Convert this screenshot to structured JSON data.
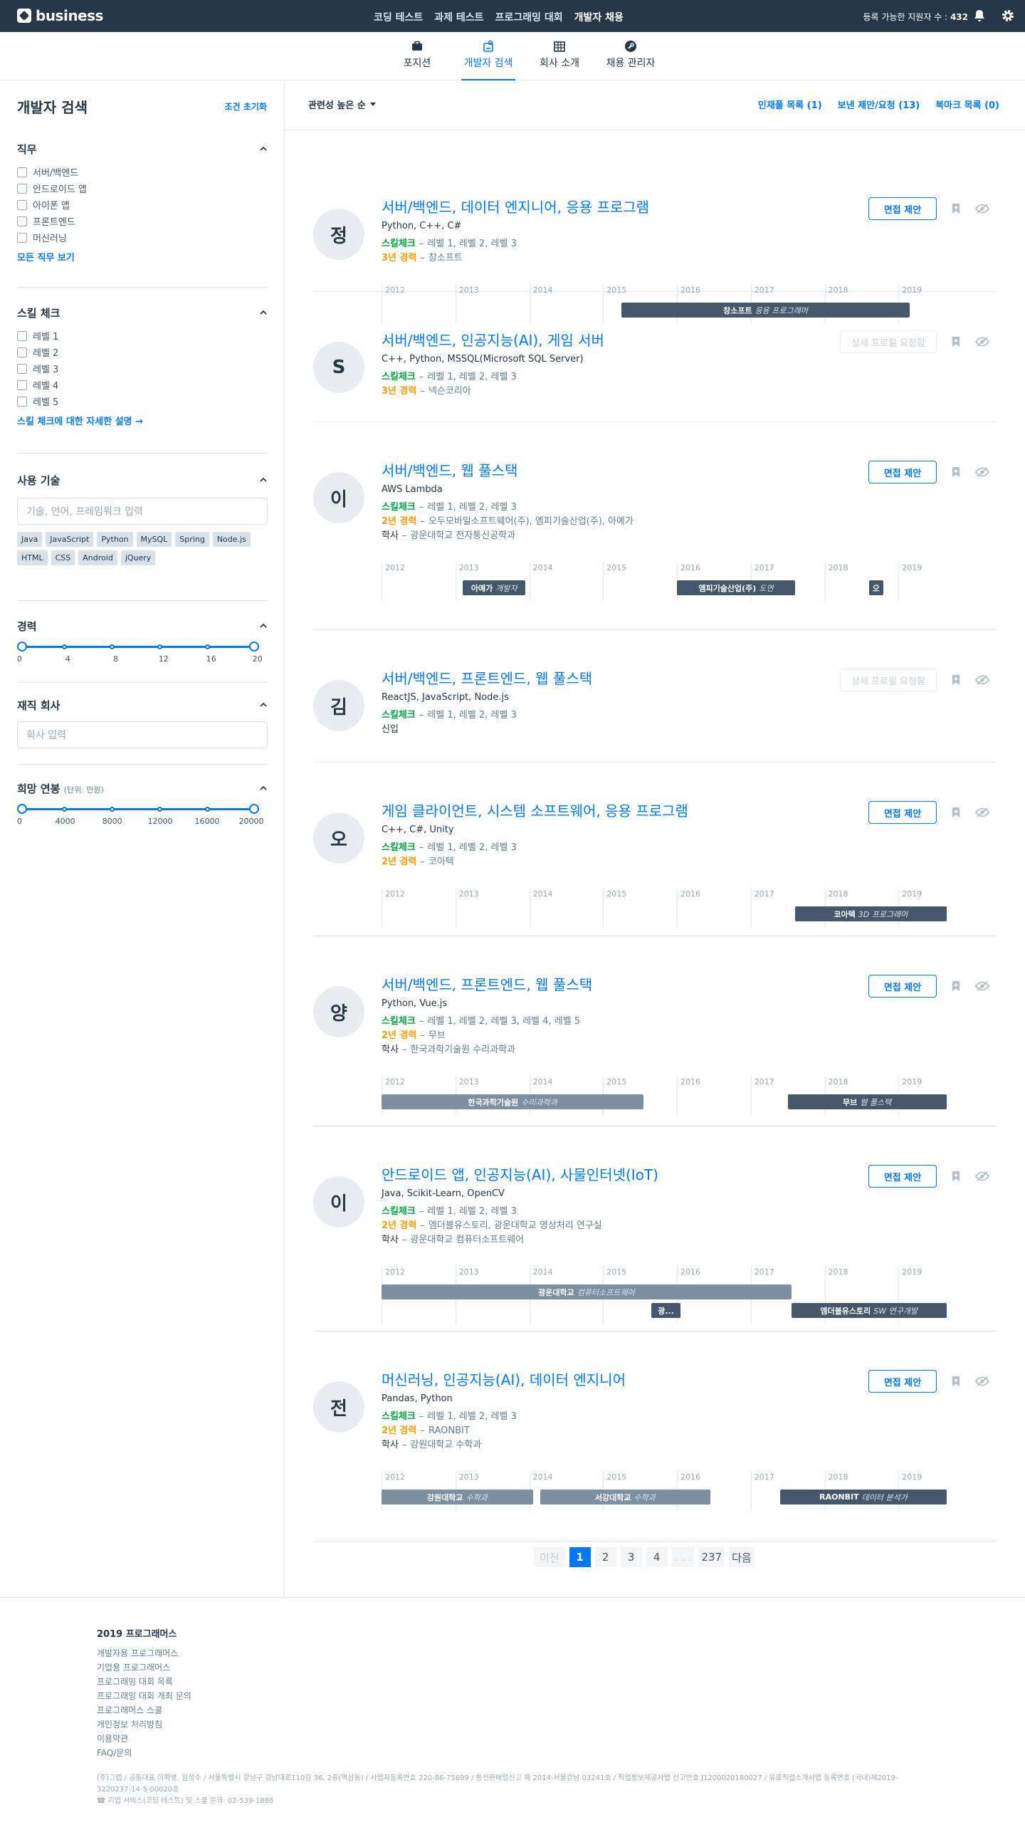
{
  "header": {
    "logo_text": "business",
    "nav": [
      "코딩 테스트",
      "과제 테스트",
      "프로그래밍 대회",
      "개발자 채용"
    ],
    "active_nav_index": 3,
    "applicant_label": "등록 가능한 지원자 수 :",
    "applicant_count": "432",
    "icons": [
      "bell-icon",
      "gear-icon"
    ]
  },
  "subnav": {
    "tabs": [
      {
        "label": "포지션",
        "icon": "briefcase-icon"
      },
      {
        "label": "개발자 검색",
        "icon": "person-search-icon"
      },
      {
        "label": "회사 소개",
        "icon": "building-icon"
      },
      {
        "label": "채용 관리자",
        "icon": "wrench-icon"
      }
    ],
    "active_index": 1
  },
  "sidebar": {
    "title": "개발자 검색",
    "reset": "조건 초기화",
    "job": {
      "title": "직무",
      "options": [
        "서버/백엔드",
        "안드로이드 앱",
        "아이폰 앱",
        "프론트엔드",
        "머신러닝"
      ],
      "more": "모든 직무 보기"
    },
    "skill": {
      "title": "스킬 체크",
      "options": [
        "레벨 1",
        "레벨 2",
        "레벨 3",
        "레벨 4",
        "레벨 5"
      ],
      "more": "스킬 체크에 대한 자세한 설명 →"
    },
    "tech": {
      "title": "사용 기술",
      "placeholder": "기술, 언어, 프레임워크 입력",
      "chips": [
        "Java",
        "JavaScript",
        "Python",
        "MySQL",
        "Spring",
        "Node.js",
        "HTML",
        "CSS",
        "Android",
        "jQuery"
      ]
    },
    "experience": {
      "title": "경력",
      "ticks": [
        "0",
        "4",
        "8",
        "12",
        "16",
        "20"
      ],
      "range": [
        0,
        20
      ]
    },
    "company": {
      "title": "재직 회사",
      "placeholder": "회사 입력"
    },
    "salary": {
      "title": "희망 연봉",
      "unit": "(단위: 만원)",
      "ticks": [
        "0",
        "4000",
        "8000",
        "12000",
        "16000",
        "20000"
      ],
      "range": [
        0,
        20000
      ]
    }
  },
  "toolbar": {
    "sort": "관련성 높은 순",
    "links": [
      "인재풀 목록 (1)",
      "보낸 제안/요청 (13)",
      "북마크 목록 (0)"
    ]
  },
  "actions": {
    "offer": "면접 제안",
    "request": "상세 프로필 요청함"
  },
  "labels": {
    "skill": "스킬체크",
    "dash": "–",
    "newbie": "신입"
  },
  "years": [
    "2012",
    "2013",
    "2014",
    "2015",
    "2016",
    "2017",
    "2018",
    "2019"
  ],
  "candidates": [
    {
      "avatar": "정",
      "title": "서버/백엔드, 데이터 엔지니어, 응용 프로그램",
      "skills": "Python, C++, C#",
      "levels": "레벨 1, 레벨 2, 레벨 3",
      "career": "3년 경력",
      "career_detail": "창소프트",
      "edu": "",
      "action": "offer",
      "bars": [
        {
          "name": "창소프트",
          "role": "응용 프로그래머",
          "type": "work",
          "from": 2015.25,
          "to": 2019.15,
          "row": 0
        }
      ]
    },
    {
      "avatar": "S",
      "title": "서버/백엔드, 인공지능(AI), 게임 서버",
      "skills": "C++, Python, MSSQL(Microsoft SQL Server)",
      "levels": "레벨 1, 레벨 2, 레벨 3",
      "career": "3년 경력",
      "career_detail": "넥슨코리아",
      "edu": "",
      "action": "request",
      "bars": []
    },
    {
      "avatar": "이",
      "title": "서버/백엔드, 웹 풀스택",
      "skills": "AWS Lambda",
      "levels": "레벨 1, 레벨 2, 레벨 3",
      "career": "2년 경력",
      "career_detail": "오두모바일소프트웨어(주), 엠피기술산업(주), 아예가",
      "edu": "광운대학교 전자통신공학과",
      "edu_label": "학사",
      "action": "offer",
      "bars": [
        {
          "name": "아예가",
          "role": "개발자",
          "type": "work",
          "from": 2013.1,
          "to": 2013.95,
          "row": 0
        },
        {
          "name": "엠피기술산업(주)",
          "role": "도연",
          "type": "work",
          "from": 2016.0,
          "to": 2017.6,
          "row": 0
        },
        {
          "name": "오",
          "role": "",
          "type": "work",
          "from": 2018.6,
          "to": 2018.75,
          "row": 0
        }
      ]
    },
    {
      "avatar": "김",
      "title": "서버/백엔드, 프론트엔드, 웹 풀스택",
      "skills": "ReactJS, JavaScript, Node.js",
      "levels": "레벨 1, 레벨 2, 레벨 3",
      "career": "",
      "career_detail": "",
      "edu": "",
      "newbie": true,
      "action": "request",
      "bars": []
    },
    {
      "avatar": "오",
      "title": "게임 클라이언트, 시스템 소프트웨어, 응용 프로그램",
      "skills": "C++, C#, Unity",
      "levels": "레벨 1, 레벨 2, 레벨 3",
      "career": "2년 경력",
      "career_detail": "코아텍",
      "edu": "",
      "action": "offer",
      "bars": [
        {
          "name": "코아텍",
          "role": "3D 프로그래머",
          "type": "work",
          "from": 2017.6,
          "to": 2019.65,
          "row": 0
        }
      ]
    },
    {
      "avatar": "양",
      "title": "서버/백엔드, 프론트엔드, 웹 풀스택",
      "skills": "Python, Vue.js",
      "levels": "레벨 1, 레벨 2, 레벨 3, 레벨 4, 레벨 5",
      "career": "2년 경력",
      "career_detail": "무브",
      "edu": "한국과학기술원 수리과학과",
      "edu_label": "학사",
      "action": "offer",
      "bars": [
        {
          "name": "한국과학기술원",
          "role": "수리과학과",
          "type": "edu",
          "from": 2012.0,
          "to": 2015.55,
          "row": 0
        },
        {
          "name": "무브",
          "role": "웹 풀스택",
          "type": "work",
          "from": 2017.5,
          "to": 2019.65,
          "row": 0
        }
      ]
    },
    {
      "avatar": "이",
      "title": "안드로이드 앱, 인공지능(AI), 사물인터넷(IoT)",
      "skills": "Java, Scikit-Learn, OpenCV",
      "levels": "레벨 1, 레벨 2, 레벨 3",
      "career": "2년 경력",
      "career_detail": "엠더블유스토리, 광운대학교 영상처리 연구실",
      "edu": "광운대학교 컴퓨터소프트웨어",
      "edu_label": "학사",
      "action": "offer",
      "bars": [
        {
          "name": "광운대학교",
          "role": "컴퓨터소프트웨어",
          "type": "edu",
          "from": 2012.0,
          "to": 2017.55,
          "row": 0
        },
        {
          "name": "광...",
          "role": "",
          "type": "work",
          "from": 2015.65,
          "to": 2016.05,
          "row": 1
        },
        {
          "name": "엠더블유스토리",
          "role": "SW 연구개발",
          "type": "work",
          "from": 2017.55,
          "to": 2019.65,
          "row": 1
        }
      ]
    },
    {
      "avatar": "전",
      "title": "머신러닝, 인공지능(AI), 데이터 엔지니어",
      "skills": "Pandas, Python",
      "levels": "레벨 1, 레벨 2, 레벨 3",
      "career": "2년 경력",
      "career_detail": "RAONBIT",
      "edu": "강원대학교 수학과",
      "edu_label": "학사",
      "action": "offer",
      "bars": [
        {
          "name": "강원대학교",
          "role": "수학과",
          "type": "edu",
          "from": 2012.0,
          "to": 2014.05,
          "row": 0
        },
        {
          "name": "서강대학교",
          "role": "수학과",
          "type": "edu",
          "from": 2014.15,
          "to": 2016.45,
          "row": 0
        },
        {
          "name": "RAONBIT",
          "role": "데이터 분석가",
          "type": "work",
          "from": 2017.4,
          "to": 2019.65,
          "row": 0
        }
      ]
    }
  ],
  "pagination": {
    "prev": "이전",
    "pages": [
      "1",
      "2",
      "3",
      "4"
    ],
    "dots": ". . .",
    "last": "237",
    "next": "다음",
    "current": "1"
  },
  "footer": {
    "title": "2019 프로그래머스",
    "links": [
      "개발자용 프로그래머스",
      "기업용 프로그래머스",
      "프로그래밍 대회 목록",
      "프로그래밍 대회 개최 문의",
      "프로그래머스 스쿨",
      "개인정보 처리방침",
      "이용약관",
      "FAQ/문의"
    ],
    "legal1": "(주)그렙 / 공동대표 이확영, 임성수 / 서울특별시 강남구 강남대로110길 36, 2층(역삼동) / 사업자등록번호 220-86-75699 / 통신판매업신고 제 2014-서울강남 03241호 / 직업정보제공사업 신고번호 J1200020180027 / 유료직업소개사업 등록번호 (국내)제2019-",
    "legal2": "3220237-14-5-00020호",
    "legal3": "☎ 기업 서비스(코딩 테스트) 및 스쿨 문의: 02-539-1886"
  },
  "colors": {
    "primary": "#0078ff",
    "navbar": "#263747",
    "skill_label": "#00a63e",
    "career_label": "#ff9d00",
    "work_bar": "#44576c",
    "edu_bar": "#7d90a3"
  }
}
